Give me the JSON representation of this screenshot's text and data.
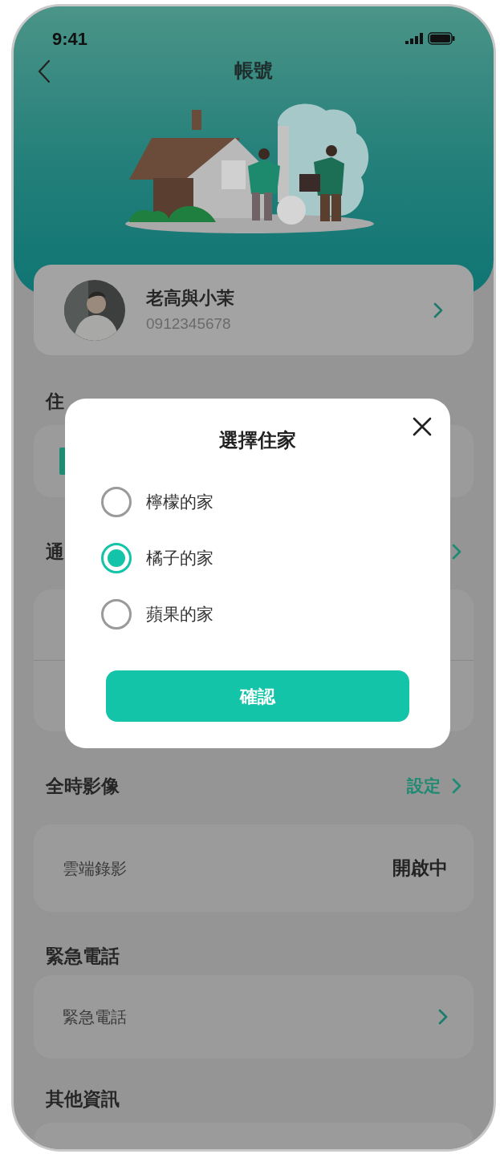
{
  "status_bar": {
    "time": "9:41"
  },
  "header": {
    "title": "帳號"
  },
  "profile": {
    "name": "老高與小茉",
    "phone": "0912345678"
  },
  "sections": [
    {
      "title": "住",
      "kind": "icon-peek"
    },
    {
      "title": "通",
      "chevron": true,
      "kind": "split"
    },
    {
      "title": "全時影像",
      "link": "設定",
      "chevron": true,
      "kind": "rows",
      "rows": [
        {
          "label": "雲端錄影",
          "value": "開啟中"
        }
      ]
    },
    {
      "title": "緊急電話",
      "kind": "rows",
      "rows": [
        {
          "label": "緊急電話",
          "chevron": true
        }
      ]
    },
    {
      "title": "其他資訊",
      "kind": "cut"
    }
  ],
  "modal": {
    "title": "選擇住家",
    "options": [
      {
        "label": "檸檬的家",
        "selected": false
      },
      {
        "label": "橘子的家",
        "selected": true
      },
      {
        "label": "蘋果的家",
        "selected": false
      }
    ],
    "confirm": "確認"
  }
}
